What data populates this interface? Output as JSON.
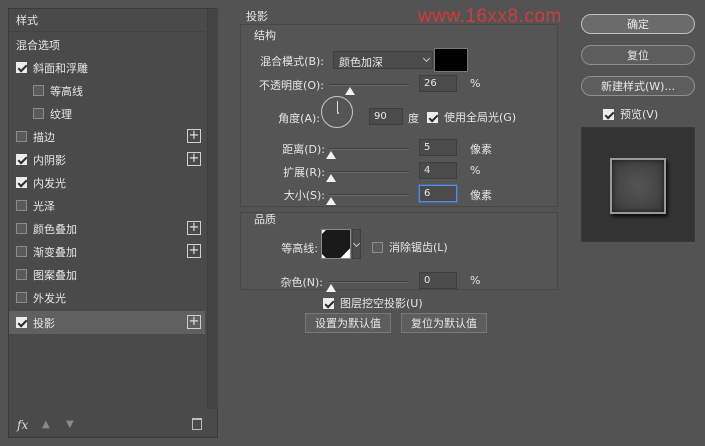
{
  "left_panel": {
    "items": [
      {
        "label": "样式",
        "type": "header"
      },
      {
        "label": "混合选项",
        "type": "header"
      },
      {
        "label": "斜面和浮雕",
        "checked": true,
        "plus": false
      },
      {
        "label": "等高线",
        "checked": false,
        "plus": false,
        "indent": true
      },
      {
        "label": "纹理",
        "checked": false,
        "plus": false,
        "indent": true
      },
      {
        "label": "描边",
        "checked": false,
        "plus": true
      },
      {
        "label": "内阴影",
        "checked": true,
        "plus": true
      },
      {
        "label": "内发光",
        "checked": true,
        "plus": false
      },
      {
        "label": "光泽",
        "checked": false,
        "plus": false
      },
      {
        "label": "颜色叠加",
        "checked": false,
        "plus": true
      },
      {
        "label": "渐变叠加",
        "checked": false,
        "plus": true
      },
      {
        "label": "图案叠加",
        "checked": false,
        "plus": false
      },
      {
        "label": "外发光",
        "checked": false,
        "plus": false
      },
      {
        "label": "投影",
        "checked": true,
        "plus": true,
        "active": true
      }
    ],
    "footer": {
      "fx": "fx",
      "up": "▲",
      "down": "▼"
    }
  },
  "settings": {
    "section_title": "投影",
    "watermark": "www.16xx8.com",
    "structure": {
      "title": "结构",
      "blend_mode_label": "混合模式(B):",
      "blend_mode_value": "颜色加深",
      "blend_color": "#000000",
      "opacity_label": "不透明度(O):",
      "opacity_value": "26",
      "opacity_unit": "%",
      "opacity_fraction": 0.26,
      "angle_label": "角度(A):",
      "angle_value": "90",
      "angle_unit": "度",
      "global_light_label": "使用全局光(G)",
      "global_light_checked": true,
      "distance_label": "距离(D):",
      "distance_value": "5",
      "distance_unit": "像素",
      "spread_label": "扩展(R):",
      "spread_value": "4",
      "spread_unit": "%",
      "size_label": "大小(S):",
      "size_value": "6",
      "size_unit": "像素"
    },
    "quality": {
      "title": "品质",
      "contour_label": "等高线:",
      "antialias_label": "消除锯齿(L)",
      "antialias_checked": false,
      "noise_label": "杂色(N):",
      "noise_value": "0",
      "noise_unit": "%"
    },
    "knockout_label": "图层挖空投影(U)",
    "knockout_checked": true,
    "make_default_label": "设置为默认值",
    "reset_default_label": "复位为默认值"
  },
  "right": {
    "ok_label": "确定",
    "reset_label": "复位",
    "new_style_label": "新建样式(W)...",
    "preview_label": "预览(V)",
    "preview_checked": true
  }
}
